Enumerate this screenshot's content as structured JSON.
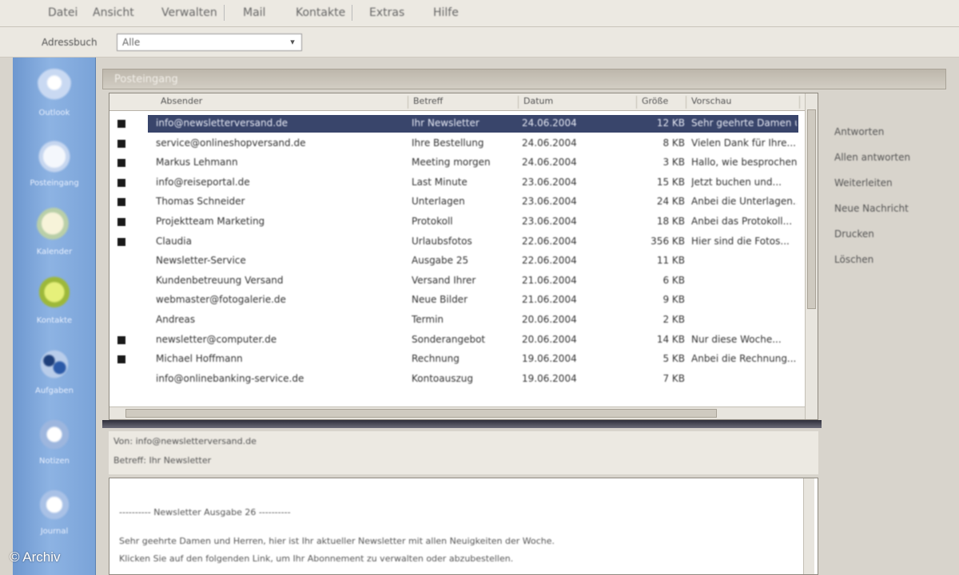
{
  "menubar": {
    "items": [
      "Datei",
      "Ansicht",
      "Verwalten",
      "Mail",
      "Kontakte",
      "Extras",
      "Hilfe"
    ]
  },
  "toolbar": {
    "label": "Adressbuch",
    "input_value": "Alle"
  },
  "sidebar": {
    "items": [
      {
        "label": "Outlook",
        "icon": "outlook-icon"
      },
      {
        "label": "Posteingang",
        "icon": "cloud-icon"
      },
      {
        "label": "Kalender",
        "icon": "calendar-icon"
      },
      {
        "label": "Kontakte",
        "icon": "contacts-icon"
      },
      {
        "label": "Aufgaben",
        "icon": "tasks-icon"
      },
      {
        "label": "Notizen",
        "icon": "notes-icon"
      },
      {
        "label": "Journal",
        "icon": "journal-icon"
      }
    ]
  },
  "main": {
    "title": "Posteingang",
    "columns": [
      "Absender",
      "Betreff",
      "Datum",
      "Größe",
      "Vorschau"
    ],
    "rows": [
      {
        "flag": true,
        "selected": true,
        "sender": "info@newsletterversand.de",
        "subject": "Ihr Newsletter",
        "date": "24.06.2004",
        "size": "12 KB",
        "preview": "Sehr geehrte Damen und..."
      },
      {
        "flag": true,
        "selected": false,
        "sender": "service@onlineshopversand.de",
        "subject": "Ihre Bestellung",
        "date": "24.06.2004",
        "size": "8 KB",
        "preview": "Vielen Dank für Ihre..."
      },
      {
        "flag": true,
        "selected": false,
        "sender": "Markus Lehmann",
        "subject": "Meeting morgen",
        "date": "24.06.2004",
        "size": "3 KB",
        "preview": "Hallo, wie besprochen..."
      },
      {
        "flag": true,
        "selected": false,
        "sender": "info@reiseportal.de",
        "subject": "Last Minute",
        "date": "23.06.2004",
        "size": "15 KB",
        "preview": "Jetzt buchen und..."
      },
      {
        "flag": true,
        "selected": false,
        "sender": "Thomas Schneider",
        "subject": "Unterlagen",
        "date": "23.06.2004",
        "size": "24 KB",
        "preview": "Anbei die Unterlagen..."
      },
      {
        "flag": true,
        "selected": false,
        "sender": "Projektteam Marketing",
        "subject": "Protokoll",
        "date": "23.06.2004",
        "size": "18 KB",
        "preview": "Anbei das Protokoll..."
      },
      {
        "flag": true,
        "selected": false,
        "sender": "Claudia",
        "subject": "Urlaubsfotos",
        "date": "22.06.2004",
        "size": "356 KB",
        "preview": "Hier sind die Fotos..."
      },
      {
        "flag": false,
        "selected": false,
        "sender": "Newsletter-Service",
        "subject": "Ausgabe 25",
        "date": "22.06.2004",
        "size": "11 KB",
        "preview": ""
      },
      {
        "flag": false,
        "selected": false,
        "sender": "Kundenbetreuung Versand",
        "subject": "Versand Ihrer",
        "date": "21.06.2004",
        "size": "6 KB",
        "preview": ""
      },
      {
        "flag": false,
        "selected": false,
        "sender": "webmaster@fotogalerie.de",
        "subject": "Neue Bilder",
        "date": "21.06.2004",
        "size": "9 KB",
        "preview": ""
      },
      {
        "flag": false,
        "selected": false,
        "sender": "Andreas",
        "subject": "Termin",
        "date": "20.06.2004",
        "size": "2 KB",
        "preview": ""
      },
      {
        "flag": true,
        "selected": false,
        "sender": "newsletter@computer.de",
        "subject": "Sonderangebot",
        "date": "20.06.2004",
        "size": "14 KB",
        "preview": "Nur diese Woche..."
      },
      {
        "flag": true,
        "selected": false,
        "sender": "Michael Hoffmann",
        "subject": "Rechnung",
        "date": "19.06.2004",
        "size": "5 KB",
        "preview": "Anbei die Rechnung..."
      },
      {
        "flag": false,
        "selected": false,
        "sender": "info@onlinebanking-service.de",
        "subject": "Kontoauszug",
        "date": "19.06.2004",
        "size": "7 KB",
        "preview": ""
      }
    ]
  },
  "right_panel": {
    "links": [
      "Antworten",
      "Allen antworten",
      "Weiterleiten",
      "Neue Nachricht",
      "Drucken",
      "Löschen"
    ]
  },
  "preview": {
    "header_from": "Von: info@newsletterversand.de",
    "header_subject": "Betreff: Ihr Newsletter",
    "lines": [
      "---------- Newsletter Ausgabe 26 ----------",
      "Sehr geehrte Damen und Herren, hier ist Ihr aktueller Newsletter mit allen Neuigkeiten der Woche.",
      "Klicken Sie auf den folgenden Link, um Ihr Abonnement zu verwalten oder abzubestellen."
    ]
  },
  "watermark": "© Archiv"
}
